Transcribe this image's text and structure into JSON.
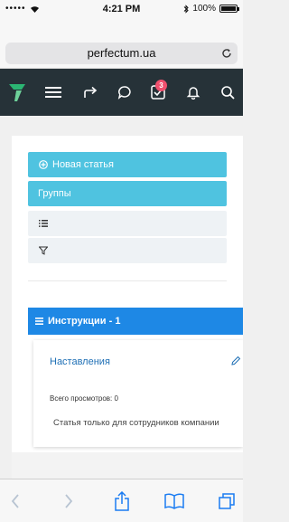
{
  "status_bar": {
    "signal": "•••••",
    "time": "4:21 PM",
    "battery_percent": "100%",
    "battery_level": 1.0
  },
  "browser": {
    "url": "perfectum.ua",
    "reload_icon": "reload-icon"
  },
  "app_header": {
    "logo_icon": "perfectum-logo-icon",
    "menu_icon": "hamburger-icon",
    "share_icon": "forward-arrow-icon",
    "chat_icon": "chat-bubble-icon",
    "tasks_icon": "checkbox-icon",
    "tasks_badge": "3",
    "bell_icon": "bell-icon",
    "search_icon": "search-icon",
    "badge_color": "#f0506e",
    "bg_color": "#263238"
  },
  "content": {
    "new_article_label": "Новая статья",
    "groups_label": "Группы",
    "list_icon": "list-icon",
    "filter_icon": "filter-icon",
    "accent_color": "#4fc3e0"
  },
  "section": {
    "title": "Инструкции - 1",
    "header_color": "#1e88e5"
  },
  "article": {
    "title": "Наставления",
    "views": "Всего просмотров: 0",
    "note": "Статья только для сотрудников компании"
  },
  "toolbar": {
    "back_icon": "chevron-left-icon",
    "forward_icon": "chevron-right-icon",
    "share_icon": "share-icon",
    "bookmarks_icon": "book-icon",
    "tabs_icon": "tabs-icon"
  }
}
